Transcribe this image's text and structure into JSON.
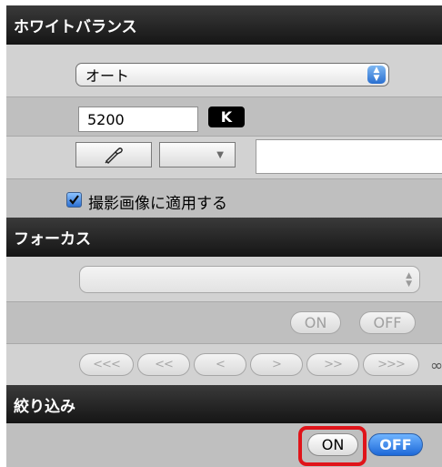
{
  "white_balance": {
    "header": "ホワイトバランス",
    "mode_value": "オート",
    "kelvin_value": "5200",
    "kelvin_unit": "K",
    "eyedropper_icon": "eyedropper-icon",
    "preset_value": "",
    "apply_label": "撮影画像に適用する",
    "apply_checked": true
  },
  "focus": {
    "header": "フォーカス",
    "select_value": "",
    "on_label": "ON",
    "off_label": "OFF",
    "nav": [
      "<<<",
      "<<",
      "<",
      ">",
      ">>",
      ">>>"
    ],
    "infinity": "∞"
  },
  "narrow": {
    "header": "絞り込み",
    "on_label": "ON",
    "off_label": "OFF",
    "active": "OFF"
  },
  "colors": {
    "header_bg": "#1f1f1f",
    "accent_blue": "#2a6fd0",
    "highlight_red": "#e0141a"
  }
}
